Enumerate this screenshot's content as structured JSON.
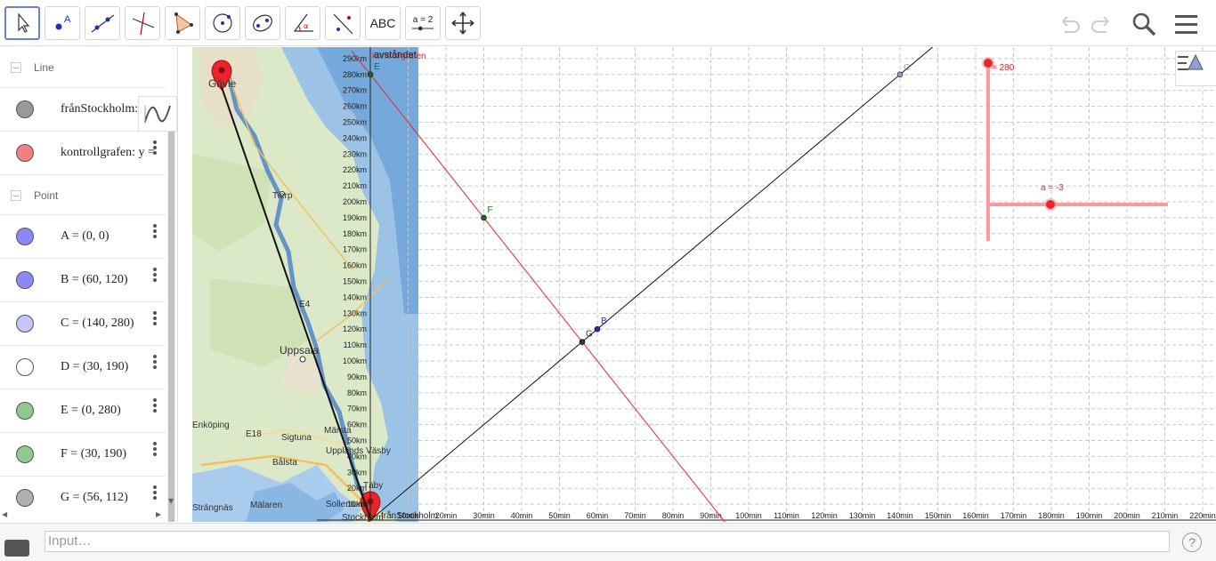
{
  "toolbar": {
    "tools": [
      {
        "name": "move-tool-button",
        "icon": "cursor-arrow-icon",
        "active": true
      },
      {
        "name": "point-tool-button",
        "icon": "point-icon"
      },
      {
        "name": "line-tool-button",
        "icon": "line-through-points-icon"
      },
      {
        "name": "perpendicular-tool-button",
        "icon": "perpendicular-line-icon"
      },
      {
        "name": "polygon-tool-button",
        "icon": "polygon-icon"
      },
      {
        "name": "circle-tool-button",
        "icon": "circle-center-point-icon"
      },
      {
        "name": "ellipse-tool-button",
        "icon": "ellipse-icon"
      },
      {
        "name": "angle-tool-button",
        "icon": "angle-icon"
      },
      {
        "name": "reflect-tool-button",
        "icon": "reflect-line-icon"
      },
      {
        "name": "text-tool-button",
        "icon": "text-icon",
        "text": "ABC"
      },
      {
        "name": "slider-tool-button",
        "icon": "slider-icon",
        "text": "a = 2"
      },
      {
        "name": "move-graphics-tool-button",
        "icon": "move-view-icon"
      }
    ],
    "right": [
      "undo-icon",
      "redo-icon",
      "search-icon",
      "hamburger-menu-icon"
    ]
  },
  "algebra": {
    "group_line": "Line",
    "group_point": "Point",
    "lines": [
      {
        "label": "frånStockholm: y = ",
        "color": "#999999"
      },
      {
        "label": "kontrollgrafen: y = ",
        "color": "#f28080"
      }
    ],
    "points": [
      {
        "label": "A = (0, 0)",
        "color": "#8a8af5"
      },
      {
        "label": "B = (60, 120)",
        "color": "#8a8af5"
      },
      {
        "label": "C = (140, 280)",
        "color": "#c5c5fa"
      },
      {
        "label": "D = (30, 190)",
        "color": "#ffffff"
      },
      {
        "label": "E = (0, 280)",
        "color": "#8fc98f"
      },
      {
        "label": "F = (30, 190)",
        "color": "#8fc98f"
      },
      {
        "label": "G = (56, 112)",
        "color": "#b0b0b0"
      }
    ]
  },
  "graphics": {
    "map_labels": [
      "Gävle",
      "Tierp",
      "Uppsala",
      "Enköping",
      "Sigtuna",
      "Märsta",
      "Upplands Väsby",
      "Bålsta",
      "Täby",
      "Sollentuna",
      "Strängnäs",
      "Mälaren",
      "Stockholm",
      "E4",
      "E18"
    ],
    "y_axis_title": "avståndet",
    "y_axis_title_overlap": "kontrollgrafen",
    "x_label_origin": "frånStockholm",
    "y_ticks": [
      "10km",
      "20km",
      "30km",
      "40km",
      "50km",
      "60km",
      "70km",
      "80km",
      "90km",
      "100km",
      "110km",
      "120km",
      "130km",
      "140km",
      "150km",
      "160km",
      "170km",
      "180km",
      "190km",
      "200km",
      "210km",
      "220km",
      "230km",
      "240km",
      "250km",
      "260km",
      "270km",
      "280km",
      "290km"
    ],
    "x_ticks": [
      "10min",
      "20min",
      "30min",
      "40min",
      "50min",
      "60min",
      "70min",
      "80min",
      "90min",
      "100min",
      "110min",
      "120min",
      "130min",
      "140min",
      "150min",
      "160min",
      "170min",
      "180min",
      "190min",
      "200min",
      "210min",
      "220min"
    ],
    "point_labels": {
      "B": "B",
      "C": "C",
      "E": "E",
      "F": "F",
      "G": "G"
    },
    "slider_vertical_label": "= 280",
    "slider_horizontal_label": "a = -3",
    "colors": {
      "red": "#e8252a",
      "grid": "#c8c8c8",
      "slider": "#f49ca0"
    }
  },
  "input": {
    "placeholder": "Input…",
    "help": "?"
  }
}
